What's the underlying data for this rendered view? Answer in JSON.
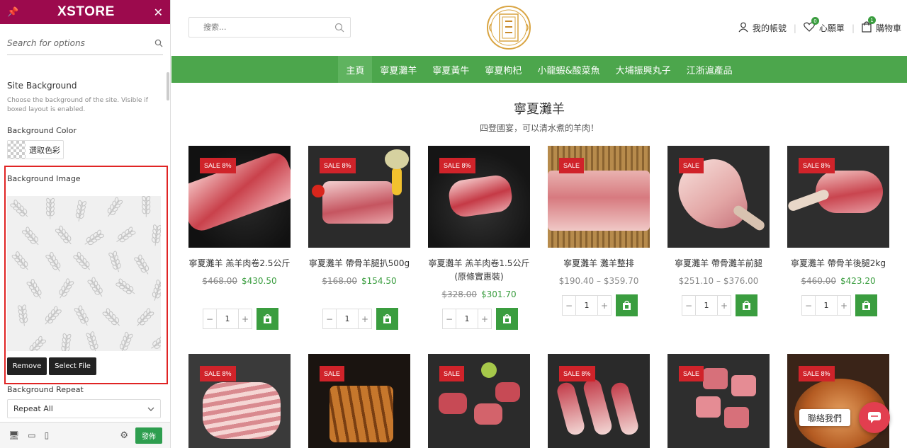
{
  "customizer": {
    "brand": "XSTORE",
    "search_placeholder": "Search for options",
    "site_background": {
      "title": "Site Background",
      "description": "Choose the background of the site. Visible if boxed layout is enabled."
    },
    "background_color": {
      "label": "Background Color",
      "picker_label": "選取色彩"
    },
    "background_image": {
      "label": "Background Image",
      "remove_label": "Remove",
      "select_label": "Select File"
    },
    "background_repeat": {
      "label": "Background Repeat",
      "value": "Repeat All"
    },
    "publish_label": "發佈",
    "accent_color": "#9c0a4d"
  },
  "store": {
    "search_placeholder": "搜索...",
    "account_label": "我的帳號",
    "wishlist_label": "心願單",
    "wishlist_count": "0",
    "cart_label": "購物車",
    "cart_count": "1",
    "nav": [
      "主頁",
      "寧夏灘羊",
      "寧夏黃牛",
      "寧夏枸杞",
      "小龍蝦&酸菜魚",
      "大埔振興丸子",
      "江浙滬產品"
    ],
    "section_title": "寧夏灘羊",
    "section_subtitle": "四登國宴，可以清水煮的羊肉！",
    "products": [
      {
        "sale": "SALE 8%",
        "name": "寧夏灘羊 羔羊肉卷2.5公斤",
        "old": "$468.00",
        "new": "$430.50",
        "qty": "1"
      },
      {
        "sale": "SALE 8%",
        "name": "寧夏灘羊 帶骨羊腿扒500g",
        "old": "$168.00",
        "new": "$154.50",
        "qty": "1"
      },
      {
        "sale": "SALE 8%",
        "name": "寧夏灘羊 羔羊肉卷1.5公斤(原條實惠裝)",
        "old": "$328.00",
        "new": "$301.70",
        "qty": "1"
      },
      {
        "sale": "SALE",
        "name": "寧夏灘羊 灘羊整排",
        "range": "$190.40 – $359.70",
        "qty": "1"
      },
      {
        "sale": "SALE",
        "name": "寧夏灘羊 帶骨灘羊前腿",
        "range": "$251.10 – $376.00",
        "qty": "1"
      },
      {
        "sale": "SALE 8%",
        "name": "寧夏灘羊 帶骨羊後腿2kg",
        "old": "$460.00",
        "new": "$423.20",
        "qty": "1"
      }
    ],
    "row2_sales": [
      "SALE 8%",
      "SALE",
      "SALE",
      "SALE 8%",
      "SALE",
      "SALE 8%"
    ],
    "chat_label": "聯絡我們",
    "nav_color": "#4ca64c",
    "price_color": "#3a9d3f",
    "sale_color": "#d0232a"
  }
}
